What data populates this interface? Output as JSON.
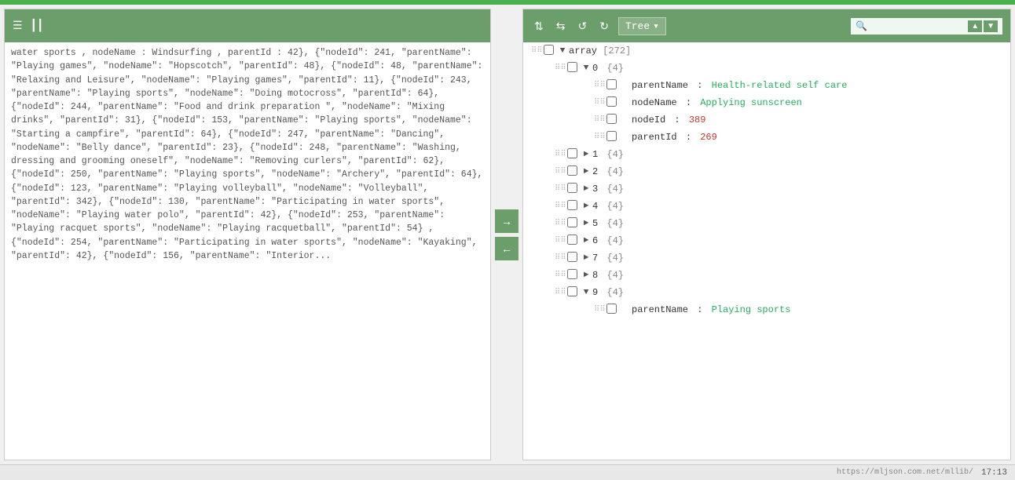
{
  "topbar": {
    "color": "#4CAF50"
  },
  "left_panel": {
    "toolbar_icons": [
      "≡",
      "≡≡"
    ],
    "content": "water sports , nodeName : Windsurfing , parentId : 42}, {\"nodeId\": 241, \"parentName\": \"Playing games\", \"nodeName\": \"Hopscotch\", \"parentId\": 48}, {\"nodeId\": 48, \"parentName\": \"Relaxing and Leisure\", \"nodeName\": \"Playing games\", \"parentId\": 11}, {\"nodeId\": 243, \"parentName\": \"Playing sports\", \"nodeName\": \"Doing motocross\", \"parentId\": 64}, {\"nodeId\": 244, \"parentName\": \"Food and drink preparation \", \"nodeName\": \"Mixing drinks\", \"parentId\": 31}, {\"nodeId\": 153, \"parentName\": \"Playing sports\", \"nodeName\": \"Starting a campfire\", \"parentId\": 64}, {\"nodeId\": 247, \"parentName\": \"Dancing\", \"nodeName\": \"Belly dance\", \"parentId\": 23}, {\"nodeId\": 248, \"parentName\": \"Washing, dressing and grooming oneself\", \"nodeName\": \"Removing curlers\", \"parentId\": 62}, {\"nodeId\": 250, \"parentName\": \"Playing sports\", \"nodeName\": \"Archery\", \"parentId\": 64}, {\"nodeId\": 123, \"parentName\": \"Playing volleyball\", \"nodeName\": \"Volleyball\", \"parentId\": 342}, {\"nodeId\": 130, \"parentName\": \"Participating in water sports\", \"nodeName\": \"Playing water polo\", \"parentId\": 42}, {\"nodeId\": 253, \"parentName\": \"Playing racquet sports\", \"nodeName\": \"Playing racquetball\", \"parentId\": 54} , {\"nodeId\": 254, \"parentName\": \"Participating in water sports\", \"nodeName\": \"Kayaking\", \"parentId\": 42}, {\"nodeId\": 156, \"parentName\": \"Interior..."
  },
  "middle": {
    "arrow_right": "→",
    "arrow_left": "←"
  },
  "right_panel": {
    "toolbar": {
      "sort_asc_icon": "↑",
      "sort_desc_icon": "↓",
      "undo_icon": "↺",
      "redo_icon": "↻",
      "tree_label": "Tree",
      "dropdown_icon": "▾",
      "search_placeholder": "",
      "search_up": "▲",
      "search_down": "▼"
    },
    "tree": {
      "root_label": "array",
      "root_count": "[272]",
      "nodes": [
        {
          "index": "0",
          "type": "{4}",
          "expanded": true,
          "properties": [
            {
              "name": "parentName",
              "value": "Health-related self care",
              "color": "green"
            },
            {
              "name": "nodeName",
              "value": "Applying sunscreen",
              "color": "green"
            },
            {
              "name": "nodeId",
              "value": "389",
              "color": "red"
            },
            {
              "name": "parentId",
              "value": "269",
              "color": "red"
            }
          ]
        },
        {
          "index": "1",
          "type": "{4}",
          "expanded": false,
          "properties": []
        },
        {
          "index": "2",
          "type": "{4}",
          "expanded": false,
          "properties": []
        },
        {
          "index": "3",
          "type": "{4}",
          "expanded": false,
          "properties": []
        },
        {
          "index": "4",
          "type": "{4}",
          "expanded": false,
          "properties": []
        },
        {
          "index": "5",
          "type": "{4}",
          "expanded": false,
          "properties": []
        },
        {
          "index": "6",
          "type": "{4}",
          "expanded": false,
          "properties": []
        },
        {
          "index": "7",
          "type": "{4}",
          "expanded": false,
          "properties": []
        },
        {
          "index": "8",
          "type": "{4}",
          "expanded": false,
          "properties": []
        },
        {
          "index": "9",
          "type": "{4}",
          "expanded": true,
          "properties": [
            {
              "name": "parentName",
              "value": "Playing sports",
              "color": "green"
            }
          ]
        }
      ]
    }
  },
  "status_bar": {
    "url": "https://mljson.com.net/mllib/",
    "time": "17:13"
  }
}
